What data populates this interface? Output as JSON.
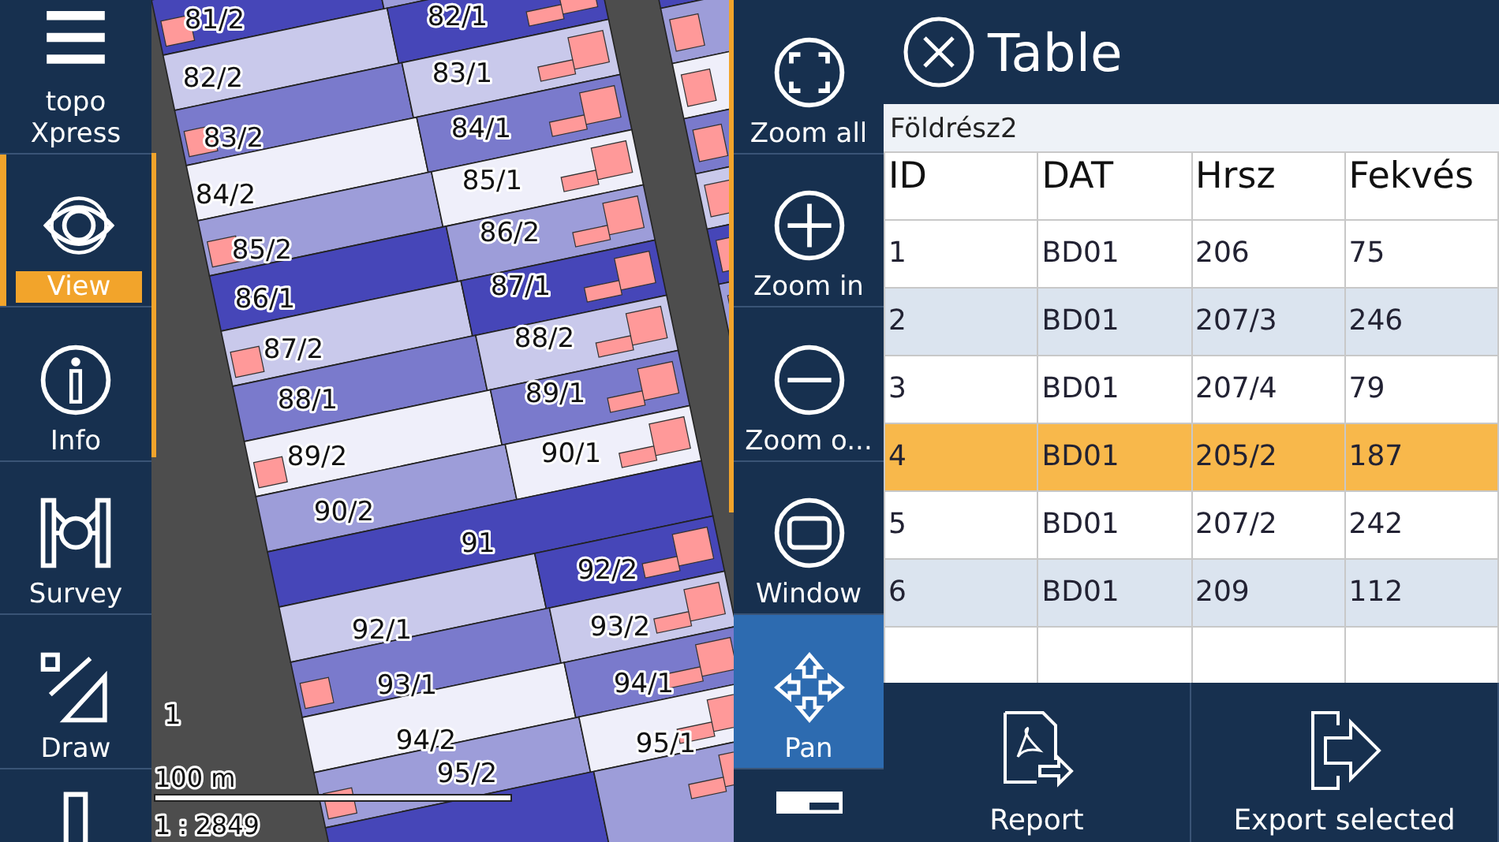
{
  "sidebar": {
    "items": [
      {
        "label": "topo Xpress",
        "selected": false
      },
      {
        "label": "View",
        "selected": true
      },
      {
        "label": "Info",
        "selected": false
      },
      {
        "label": "Survey",
        "selected": false
      },
      {
        "label": "Draw",
        "selected": false
      },
      {
        "selected": false
      }
    ]
  },
  "map": {
    "parcel_labels": [
      "81/2",
      "82/1",
      "82/2",
      "83/1",
      "83/2",
      "84/1",
      "84/2",
      "85/1",
      "85/2",
      "86/2",
      "86/1",
      "87/1",
      "87/2",
      "88/2",
      "88/1",
      "89/1",
      "89/2",
      "90/1",
      "90/2",
      "91",
      "92/2",
      "92/1",
      "93/2",
      "93/1",
      "94/1",
      "94/2",
      "95/1",
      "95/2",
      "1"
    ],
    "scale": "100 m",
    "ratio": "1 : 2849"
  },
  "tools": {
    "items": [
      {
        "label": "Zoom all",
        "selected": false
      },
      {
        "label": "Zoom in",
        "selected": false
      },
      {
        "label": "Zoom o...",
        "selected": false
      },
      {
        "label": "Window",
        "selected": false
      },
      {
        "label": "Pan",
        "selected": true
      },
      {
        "selected": false
      }
    ]
  },
  "table_panel": {
    "title": "Table",
    "layer": "Földrész2",
    "columns": [
      "ID",
      "DAT",
      "Hrsz",
      "Fekvés"
    ],
    "rows": [
      {
        "cells": [
          "1",
          "BD01",
          "206",
          "75"
        ],
        "selected": false
      },
      {
        "cells": [
          "2",
          "BD01",
          "207/3",
          "246"
        ],
        "selected": false
      },
      {
        "cells": [
          "3",
          "BD01",
          "207/4",
          "79"
        ],
        "selected": false
      },
      {
        "cells": [
          "4",
          "BD01",
          "205/2",
          "187"
        ],
        "selected": true
      },
      {
        "cells": [
          "5",
          "BD01",
          "207/2",
          "242"
        ],
        "selected": false
      },
      {
        "cells": [
          "6",
          "BD01",
          "209",
          "112"
        ],
        "selected": false
      }
    ],
    "buttons": [
      "Report",
      "Export selected"
    ]
  }
}
